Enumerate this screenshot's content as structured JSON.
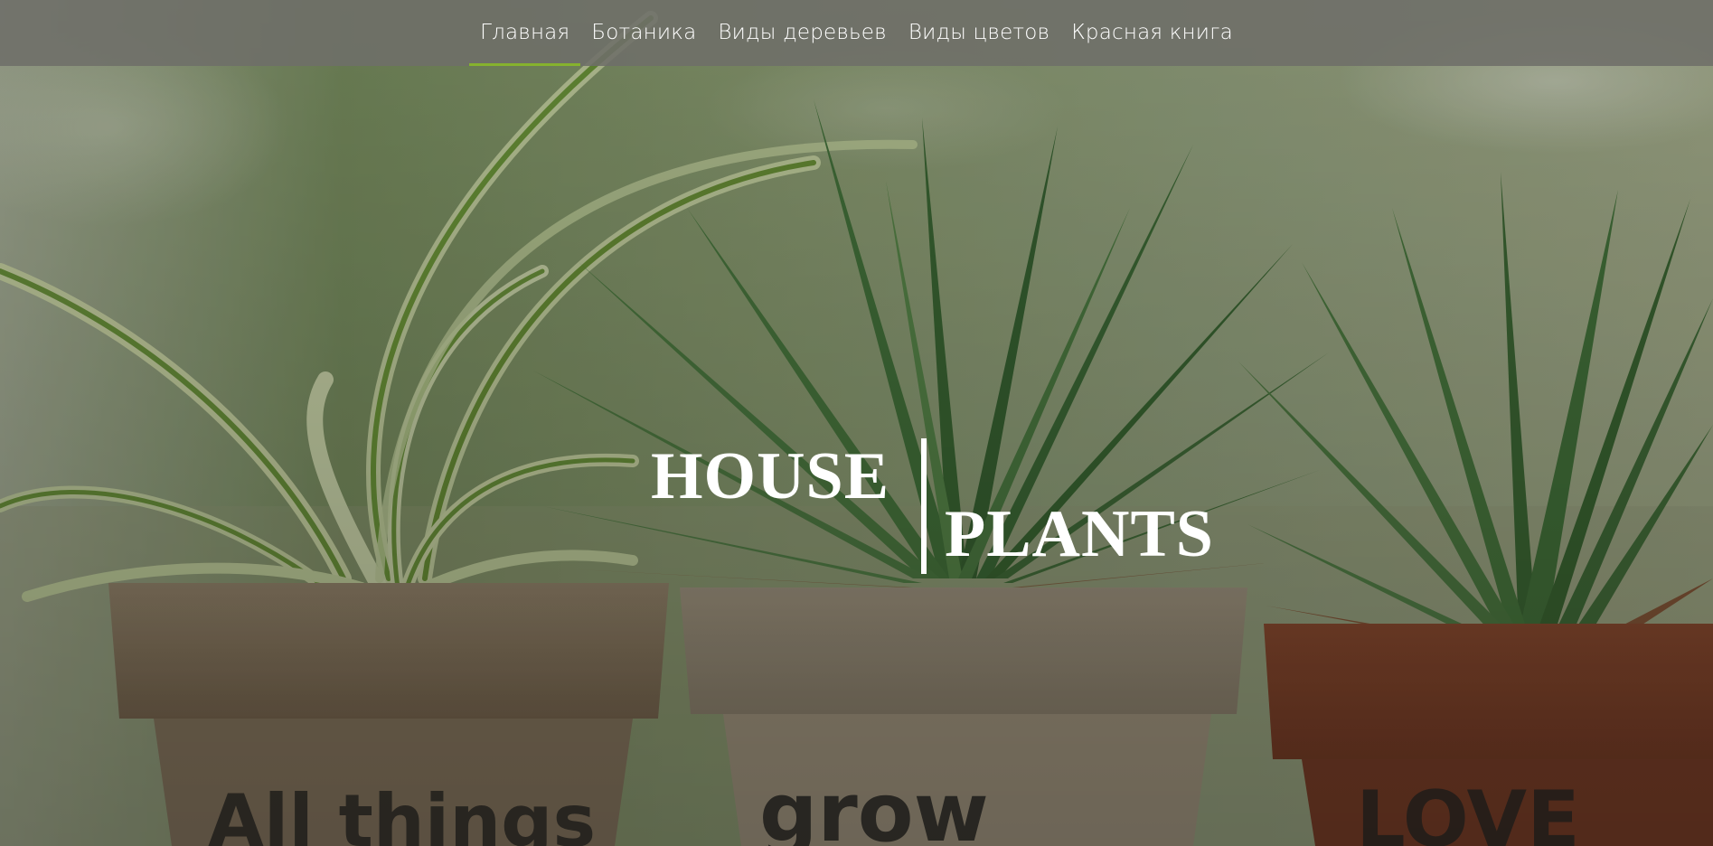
{
  "nav": {
    "items": [
      {
        "label": "Главная",
        "active": true
      },
      {
        "label": "Ботаника",
        "active": false
      },
      {
        "label": "Виды деревьев",
        "active": false
      },
      {
        "label": "Виды цветов",
        "active": false
      },
      {
        "label": "Красная книга",
        "active": false
      }
    ],
    "accent_color": "#86b22e"
  },
  "hero": {
    "title_left": "HOUSE",
    "title_right": "PLANTS",
    "image_description_icons": [
      "spider-plant",
      "aloe-plant",
      "aloe-plant"
    ],
    "pot_texts": [
      "All things",
      "grow",
      "LOVE"
    ]
  }
}
